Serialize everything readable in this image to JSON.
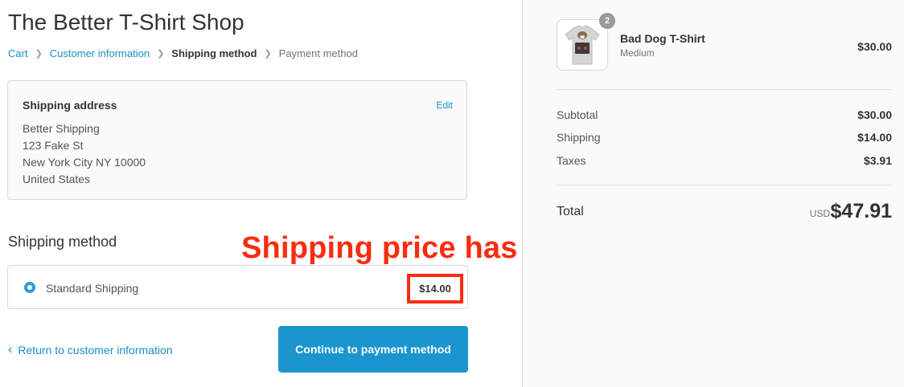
{
  "shop": {
    "title": "The Better T-Shirt Shop"
  },
  "breadcrumb": {
    "items": [
      {
        "label": "Cart",
        "state": "link"
      },
      {
        "label": "Customer information",
        "state": "link"
      },
      {
        "label": "Shipping method",
        "state": "current"
      },
      {
        "label": "Payment method",
        "state": "upcoming"
      }
    ]
  },
  "shipping_address": {
    "heading": "Shipping address",
    "edit_label": "Edit",
    "lines": [
      "Better Shipping",
      "123 Fake St",
      "New York City NY 10000",
      "United States"
    ]
  },
  "shipping_method": {
    "heading": "Shipping method",
    "option": {
      "name": "Standard Shipping",
      "price": "$14.00",
      "selected": true
    }
  },
  "annotation": {
    "text": "Shipping price has updated",
    "color": "#fa2c10"
  },
  "actions": {
    "return_label": "Return to customer information",
    "continue_label": "Continue to payment method"
  },
  "order_summary": {
    "product": {
      "name": "Bad Dog T-Shirt",
      "variant": "Medium",
      "price": "$30.00",
      "quantity": "2"
    },
    "subtotal": {
      "label": "Subtotal",
      "value": "$30.00"
    },
    "shipping": {
      "label": "Shipping",
      "value": "$14.00"
    },
    "taxes": {
      "label": "Taxes",
      "value": "$3.91"
    },
    "total": {
      "label": "Total",
      "currency": "USD",
      "value": "$47.91"
    }
  },
  "colors": {
    "accent": "#1990c6",
    "button": "#1a95ce",
    "annotation": "#fa2c10"
  }
}
